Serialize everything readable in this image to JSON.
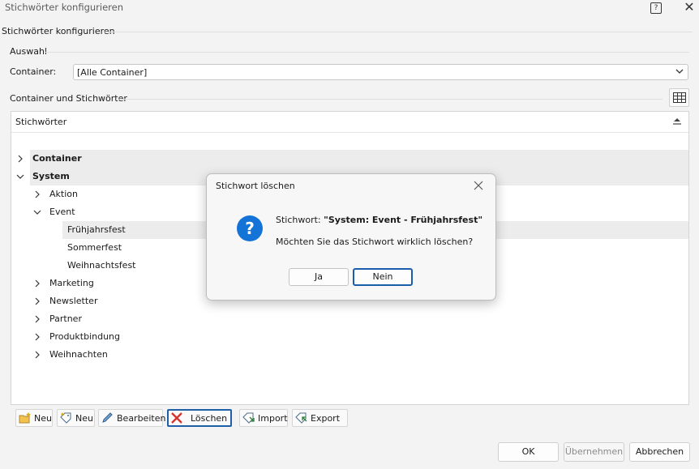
{
  "window": {
    "title": "Stichwörter konfigurieren"
  },
  "section": {
    "title": "Stichwörter konfigurieren",
    "auswahl": "Auswahl",
    "container_label": "Container:",
    "container_value": "[Alle Container]",
    "container_tree_label": "Container und Stichwörter"
  },
  "tree": {
    "header": "Stichwörter",
    "rows": [
      {
        "label": "Container",
        "bold": true,
        "level": 0,
        "chevron": "right",
        "highlight": true
      },
      {
        "label": "System",
        "bold": true,
        "level": 0,
        "chevron": "down",
        "highlight": true
      },
      {
        "label": "Aktion",
        "level": 1,
        "chevron": "right"
      },
      {
        "label": "Event",
        "level": 1,
        "chevron": "down"
      },
      {
        "label": "Frühjahrsfest",
        "level": 2,
        "selected": true
      },
      {
        "label": "Sommerfest",
        "level": 2
      },
      {
        "label": "Weihnachtsfest",
        "level": 2
      },
      {
        "label": "Marketing",
        "level": 1,
        "chevron": "right"
      },
      {
        "label": "Newsletter",
        "level": 1,
        "chevron": "right"
      },
      {
        "label": "Partner",
        "level": 1,
        "chevron": "right"
      },
      {
        "label": "Produktbindung",
        "level": 1,
        "chevron": "right"
      },
      {
        "label": "Weihnachten",
        "level": 1,
        "chevron": "right"
      }
    ]
  },
  "toolbar": {
    "new_container": "Neu",
    "new_keyword": "Neu",
    "edit": "Bearbeiten",
    "delete": "Löschen",
    "import": "Import",
    "export": "Export"
  },
  "footer": {
    "ok": "OK",
    "apply": "Übernehmen",
    "cancel": "Abbrechen"
  },
  "dialog": {
    "title": "Stichwort löschen",
    "msg_prefix": "Stichwort: ",
    "msg_keyword": "\"System: Event - Frühjahrsfest\"",
    "question": "Möchten Sie das Stichwort wirklich löschen?",
    "yes": "Ja",
    "no": "Nein"
  },
  "colors": {
    "accent": "#1473d6",
    "focus_border": "#1f5fa8",
    "delete_icon": "#d9342b"
  }
}
